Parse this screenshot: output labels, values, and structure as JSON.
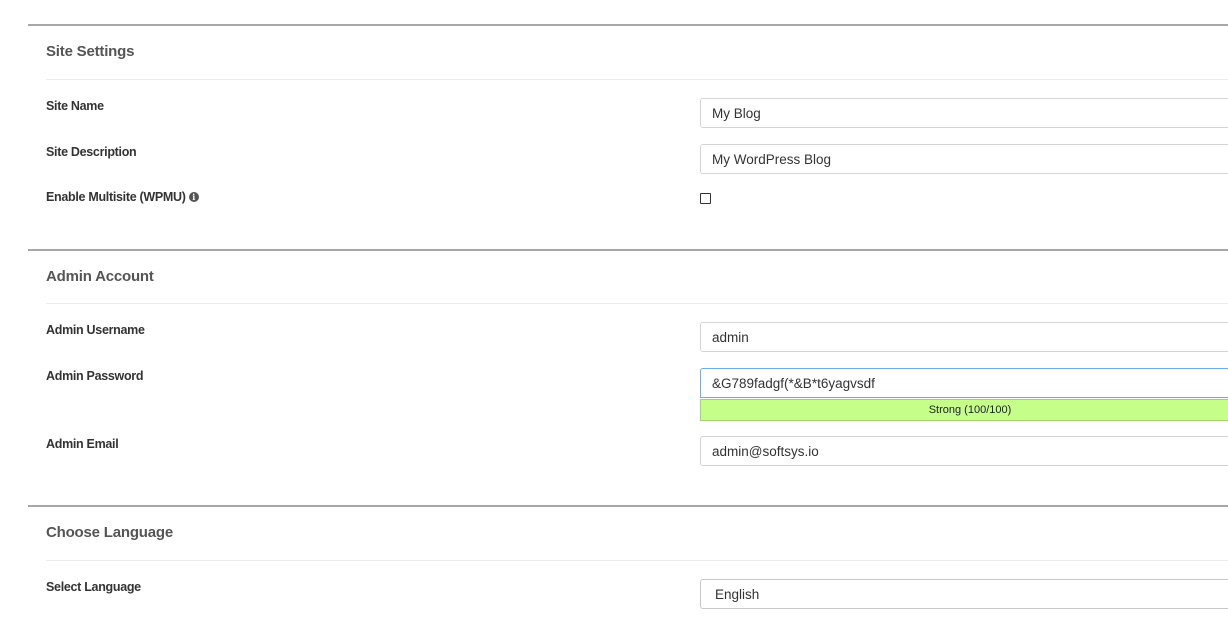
{
  "site_settings": {
    "title": "Site Settings",
    "site_name": {
      "label": "Site Name",
      "value": "My Blog"
    },
    "site_description": {
      "label": "Site Description",
      "value": "My WordPress Blog"
    },
    "multisite": {
      "label": "Enable Multisite (WPMU)",
      "checked": false,
      "icon": "info-icon"
    }
  },
  "admin_account": {
    "title": "Admin Account",
    "username": {
      "label": "Admin Username",
      "value": "admin"
    },
    "password": {
      "label": "Admin Password",
      "value": "&G789fadgf(*&B*t6yagvsdf",
      "strength_text": "Strong (100/100)",
      "strength_score": 100,
      "strength_color": "#c5ff8a"
    },
    "email": {
      "label": "Admin Email",
      "value": "admin@softsys.io"
    }
  },
  "choose_language": {
    "title": "Choose Language",
    "language": {
      "label": "Select Language",
      "selected": "English"
    }
  }
}
